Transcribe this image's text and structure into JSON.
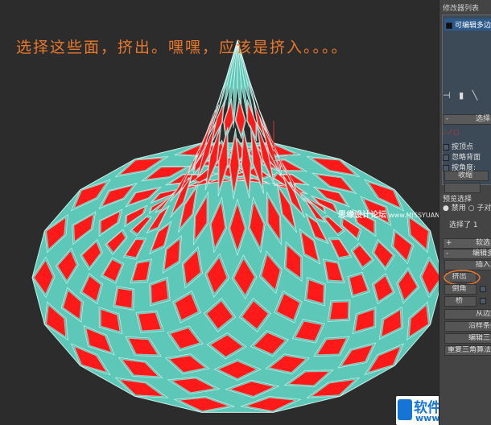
{
  "caption": "选择这些面，挤出。嘿嘿，应该是挤入。。。。",
  "watermark": {
    "site": "思缘设计论坛",
    "url": "www.MISSYUAN.COM"
  },
  "logo": {
    "name": "软件自学网",
    "url": "www.rjzxw.com"
  },
  "colors": {
    "face": "#ff1a1a",
    "edge": "#5ec8b8",
    "background": "#2c2c2c",
    "caption": "#e8782a"
  },
  "panel": {
    "modifier_list": "修改器列表",
    "stack_item": "可编辑多边形",
    "selection_rollout": "选择",
    "by_vertex": "按顶点",
    "ignore_backfacing": "忽略背面",
    "by_angle": "按角度:",
    "shrink": "收缩",
    "preview_selection": "预览选择",
    "disabled": "禁用",
    "subobject": "子对",
    "selected": "选择了 1",
    "soft_selection": "软选",
    "edit_polygons": "编辑多",
    "insert_vertex": "插入顶",
    "extrude": "挤出",
    "bevel": "倒角",
    "bridge": "桥",
    "hinge_from_edge": "从边旋",
    "extrude_along_spline": "沿样条线",
    "edit_triangulation": "编辑三角",
    "retriangulate": "重复三角算法"
  }
}
